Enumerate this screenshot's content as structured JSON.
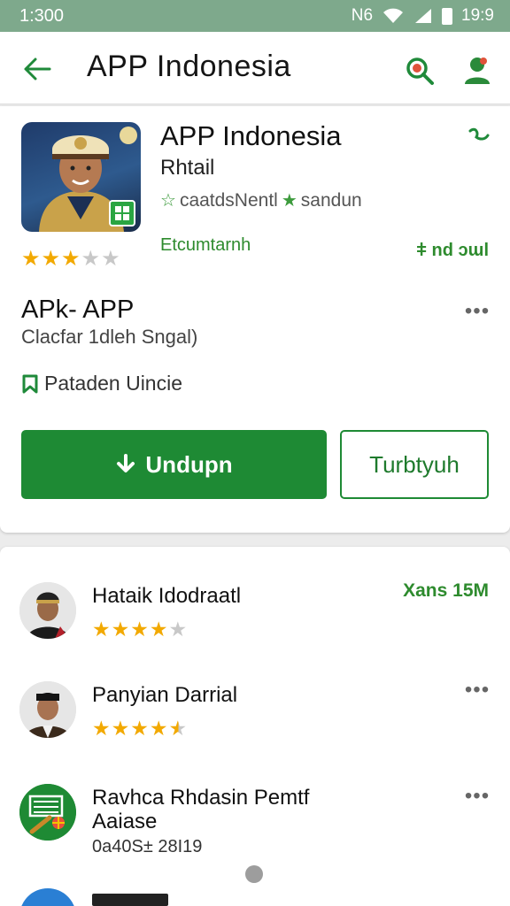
{
  "status_bar": {
    "time": "1:300",
    "signal_text": "N6",
    "clock_right": "19:9"
  },
  "app_bar": {
    "title": "APP Indonesia"
  },
  "app": {
    "name": "APP Indonesia",
    "developer": "Rhtail",
    "tag_1": "caatdsNentl",
    "tag_2": "sandun",
    "green_link": "Etcumtarnh",
    "green_right": "ǂ nd ɔɯl",
    "rating": 3,
    "rating_max": 5
  },
  "apk": {
    "title": "APk- APP",
    "subtitle": "Clacfar 1dleh Sngal)",
    "badge_text": "Pataden Uincie"
  },
  "buttons": {
    "install": "Undupn",
    "secondary": "Turbtyuh"
  },
  "list": [
    {
      "title": "Hataik Idodraatl",
      "rating": 4,
      "size": "Xans 15M"
    },
    {
      "title": "Panyian Darrial",
      "rating": 4.5
    },
    {
      "title": "Ravhca Rhdasin Pemtf",
      "subtitle": "Aaiase",
      "meta": "0a40S± 28I19"
    }
  ],
  "colors": {
    "status_bar": "#7ea98c",
    "primary_green": "#1e8a34",
    "star": "#f2a900"
  }
}
